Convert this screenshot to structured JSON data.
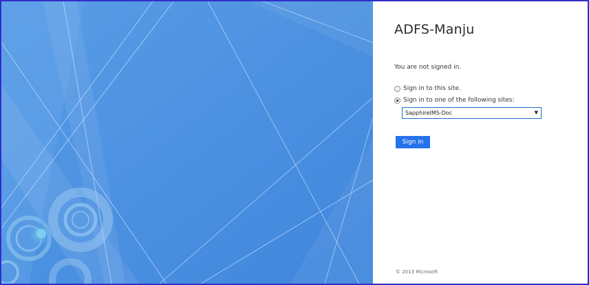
{
  "page": {
    "title": "ADFS-Manju",
    "status_text": "You are not signed in.",
    "options": [
      {
        "label": "Sign in to this site.",
        "checked": false
      },
      {
        "label": "Sign in to one of the following sites:",
        "checked": true
      }
    ],
    "site_select": {
      "selected": "SapphireIMS-Doc"
    },
    "sign_in_label": "Sign in",
    "footer": "© 2013 Microsoft"
  },
  "colors": {
    "illustration_blue": "#4a90e0",
    "button_blue": "#2672ec",
    "frame_border": "#2f2fc8"
  }
}
